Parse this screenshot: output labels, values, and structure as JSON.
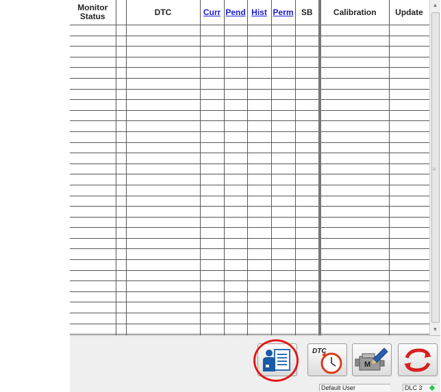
{
  "table": {
    "columns": [
      {
        "label": "Monitor Status",
        "link": false
      },
      {
        "label": "",
        "link": false
      },
      {
        "label": "DTC",
        "link": false
      },
      {
        "label": "Curr",
        "link": true
      },
      {
        "label": "Pend",
        "link": true
      },
      {
        "label": "Hist",
        "link": true
      },
      {
        "label": "Perm",
        "link": true
      },
      {
        "label": "SB",
        "link": false
      },
      {
        "label": "Calibration",
        "link": false
      },
      {
        "label": "Update",
        "link": false
      }
    ],
    "empty_row_count": 30
  },
  "toolbar": {
    "buttons": [
      {
        "name": "user-report-button",
        "icon": "user-document-icon",
        "highlighted": true
      },
      {
        "name": "dtc-clear-timer-button",
        "icon": "dtc-timer-icon",
        "label": "DTC"
      },
      {
        "name": "engine-edit-button",
        "icon": "engine-pencil-icon",
        "label": "M"
      },
      {
        "name": "refresh-button",
        "icon": "refresh-arrows-icon"
      }
    ]
  },
  "status_bar": {
    "user": "Default User",
    "connection": "DLC 3",
    "connection_color": "#22c84a"
  },
  "colors": {
    "link": "#1b1bd8",
    "highlight_circle": "#e41818",
    "toolbar_bg": "#efefef"
  }
}
